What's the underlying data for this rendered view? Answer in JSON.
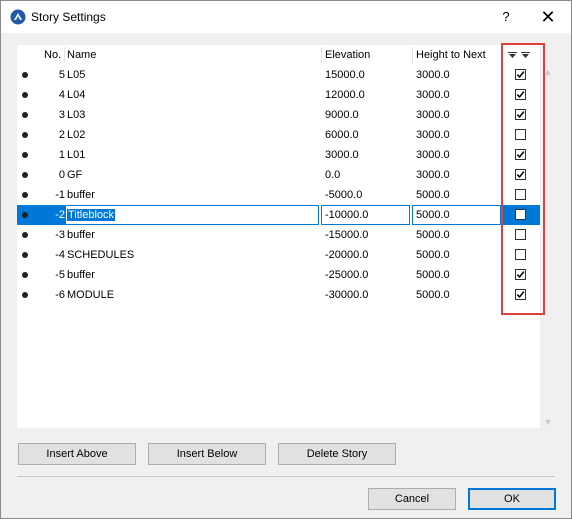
{
  "window": {
    "title": "Story Settings",
    "help_label": "?",
    "close_label": "✕"
  },
  "table": {
    "columns": {
      "no": "No.",
      "name": "Name",
      "elevation": "Elevation",
      "height": "Height to Next"
    },
    "rows": [
      {
        "no": "5",
        "name": "L05",
        "elevation": "15000.0",
        "height": "3000.0",
        "checked": true
      },
      {
        "no": "4",
        "name": "L04",
        "elevation": "12000.0",
        "height": "3000.0",
        "checked": true
      },
      {
        "no": "3",
        "name": "L03",
        "elevation": "9000.0",
        "height": "3000.0",
        "checked": true
      },
      {
        "no": "2",
        "name": "L02",
        "elevation": "6000.0",
        "height": "3000.0",
        "checked": false
      },
      {
        "no": "1",
        "name": "L01",
        "elevation": "3000.0",
        "height": "3000.0",
        "checked": true
      },
      {
        "no": "0",
        "name": "GF",
        "elevation": "0.0",
        "height": "3000.0",
        "checked": true
      },
      {
        "no": "-1",
        "name": "buffer",
        "elevation": "-5000.0",
        "height": "5000.0",
        "checked": false
      },
      {
        "no": "-2",
        "name": "Titleblock",
        "elevation": "-10000.0",
        "height": "5000.0",
        "checked": false,
        "selected": true
      },
      {
        "no": "-3",
        "name": "buffer",
        "elevation": "-15000.0",
        "height": "5000.0",
        "checked": false
      },
      {
        "no": "-4",
        "name": "SCHEDULES",
        "elevation": "-20000.0",
        "height": "5000.0",
        "checked": false
      },
      {
        "no": "-5",
        "name": "buffer",
        "elevation": "-25000.0",
        "height": "5000.0",
        "checked": true
      },
      {
        "no": "-6",
        "name": "MODULE",
        "elevation": "-30000.0",
        "height": "5000.0",
        "checked": true
      }
    ]
  },
  "buttons": {
    "insert_above": "Insert Above",
    "insert_below": "Insert Below",
    "delete_story": "Delete Story",
    "cancel": "Cancel",
    "ok": "OK"
  },
  "colors": {
    "selection": "#0078d7",
    "highlight_box": "#e0403a"
  }
}
